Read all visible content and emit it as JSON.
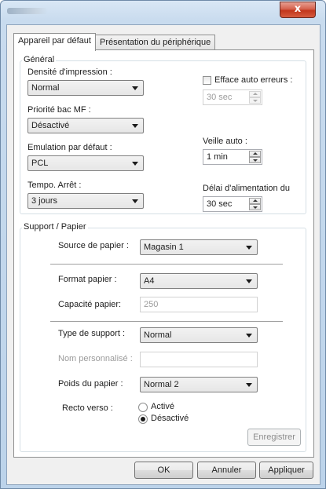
{
  "window": {
    "close_glyph": "x",
    "close_icon": "close-icon"
  },
  "tabs": [
    {
      "label": "Appareil par défaut",
      "selected": true
    },
    {
      "label": "Présentation du périphérique",
      "selected": false
    }
  ],
  "general": {
    "legend": "Général",
    "print_density": {
      "label": "Densité d'impression :",
      "value": "Normal"
    },
    "mp_tray_priority": {
      "label": "Priorité bac MF :",
      "value": "Désactivé"
    },
    "default_emulation": {
      "label": "Emulation par défaut :",
      "value": "PCL"
    },
    "stop_timer": {
      "label": "Tempo. Arrêt :",
      "value": "3 jours"
    },
    "auto_error_clear": {
      "label": "Efface auto erreurs :",
      "checked": false,
      "value": "30 sec"
    },
    "auto_sleep": {
      "label": "Veille auto :",
      "value": "1 min"
    },
    "feed_delay": {
      "label": "Délai d'alimentation du",
      "value": "30 sec"
    }
  },
  "media": {
    "legend": "Support / Papier",
    "paper_source": {
      "label": "Source de papier :",
      "value": "Magasin 1"
    },
    "paper_size": {
      "label": "Format papier :",
      "value": "A4"
    },
    "paper_capacity": {
      "label": "Capacité papier:",
      "value": "250"
    },
    "media_type": {
      "label": "Type de support :",
      "value": "Normal"
    },
    "custom_name": {
      "label": "Nom personnalisé :",
      "value": ""
    },
    "paper_weight": {
      "label": "Poids du papier :",
      "value": "Normal 2"
    },
    "duplex": {
      "label": "Recto verso :",
      "options": [
        "Activé",
        "Désactivé"
      ],
      "selected": "Désactivé"
    },
    "save_label": "Enregistrer"
  },
  "buttons": {
    "ok": "OK",
    "cancel": "Annuler",
    "apply": "Appliquer"
  }
}
